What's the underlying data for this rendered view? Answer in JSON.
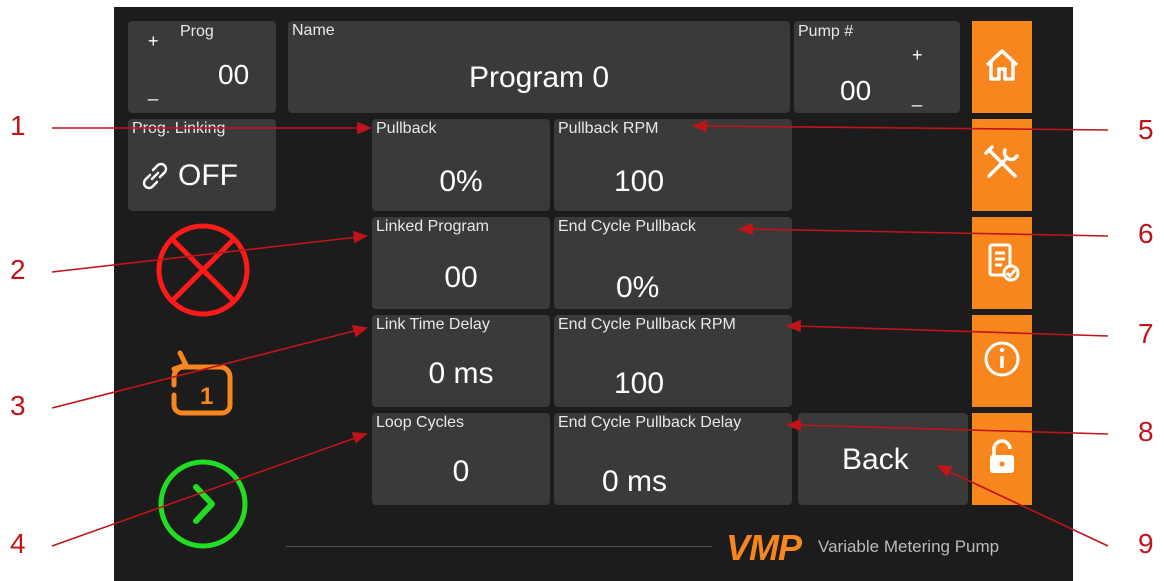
{
  "prog": {
    "label": "Prog",
    "plus": "+",
    "minus": "_",
    "value": "00"
  },
  "name": {
    "label": "Name",
    "value": "Program 0"
  },
  "pump": {
    "label": "Pump #",
    "plus": "+",
    "minus": "_",
    "value": "00"
  },
  "prog_linking": {
    "label": "Prog. Linking",
    "value": "OFF"
  },
  "params": {
    "pullback": {
      "label": "Pullback",
      "value": "0%"
    },
    "pullback_rpm": {
      "label": "Pullback RPM",
      "value": "100"
    },
    "linked_program": {
      "label": "Linked Program",
      "value": "00"
    },
    "end_cycle_pullback": {
      "label": "End Cycle Pullback",
      "value": "0%"
    },
    "link_time_delay": {
      "label": "Link Time Delay",
      "value": "0 ms"
    },
    "end_cycle_pullback_rpm": {
      "label": "End Cycle Pullback RPM",
      "value": "100"
    },
    "loop_cycles": {
      "label": "Loop Cycles",
      "value": "0"
    },
    "end_cycle_pullback_delay": {
      "label": "End Cycle Pullback Delay",
      "value": "0 ms"
    }
  },
  "back_button": {
    "label": "Back"
  },
  "brand": {
    "logo": "VMP",
    "tagline": "Variable Metering Pump"
  },
  "callouts": [
    "1",
    "2",
    "3",
    "4",
    "5",
    "6",
    "7",
    "8",
    "9"
  ],
  "icons": [
    "home-icon",
    "tools-icon",
    "clipboard-check-icon",
    "info-icon",
    "unlock-icon",
    "stop-icon",
    "loop-once-icon",
    "start-icon",
    "link-icon"
  ],
  "colors": {
    "accent": "#f7861e",
    "stop": "#ff1a1a",
    "start": "#22dd22",
    "callout": "#c0141a",
    "tile": "#3a3a3a",
    "background": "#1c1c1c"
  }
}
